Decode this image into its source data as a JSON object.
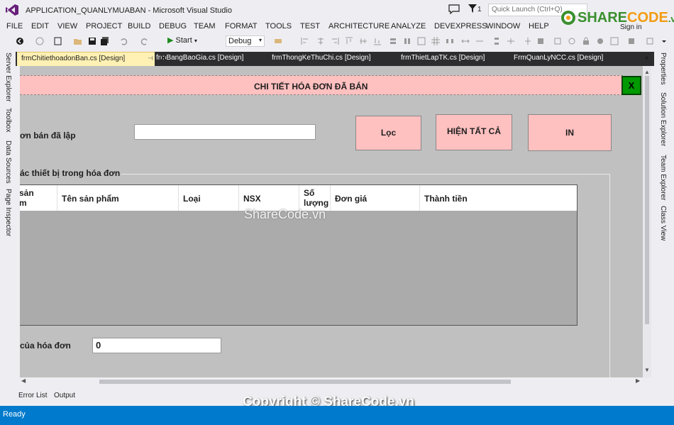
{
  "window": {
    "title": "APPLICATION_QUANLYMUABAN - Microsoft Visual Studio",
    "filter_count": "1",
    "quick_launch_placeholder": "Quick Launch (Ctrl+Q)",
    "sign_in": "Sign in"
  },
  "menu": [
    "FILE",
    "EDIT",
    "VIEW",
    "PROJECT",
    "BUILD",
    "DEBUG",
    "TEAM",
    "FORMAT",
    "TOOLS",
    "TEST",
    "ARCHITECTURE",
    "ANALYZE",
    "DEVEXPRESS",
    "WINDOW",
    "HELP"
  ],
  "toolbar": {
    "start_label": "Start",
    "config_value": "Debug"
  },
  "left_rail": [
    "Server Explorer",
    "Toolbox",
    "Data Sources",
    "Page Inspector"
  ],
  "right_rail": [
    "Properties",
    "Solution Explorer",
    "Team Explorer",
    "Class View"
  ],
  "doc_tabs": [
    {
      "label": "frmChitiethoadonBan.cs [Design]",
      "active": true
    },
    {
      "label": "frmBangBaoGia.cs [Design]",
      "active": false
    },
    {
      "label": "frmThongKeThuChi.cs [Design]",
      "active": false
    },
    {
      "label": "frmThietLapTK.cs [Design]",
      "active": false
    },
    {
      "label": "FrmQuanLyNCC.cs [Design]",
      "active": false
    }
  ],
  "form": {
    "title": "CHI TIẾT HÓA ĐƠN ĐÃ BÁN",
    "close_label": "X",
    "invoice_label": "ơn bán đã lập",
    "invoice_value": "",
    "filter_button": "Lọc",
    "show_all_button": "HIỆN TẤT CẢ",
    "print_button": "IN",
    "group_title": "ác thiết bị trong hóa đơn",
    "columns": [
      "sản\nm",
      "Tên sản phẩm",
      "Loại",
      "NSX",
      "Số\nlượng",
      "Đơn giá",
      "Thành tiền"
    ],
    "total_label": "của hóa đơn",
    "total_value": "0"
  },
  "bottom_tabs": [
    "Error List",
    "Output"
  ],
  "status": "Ready",
  "watermark": {
    "center": "ShareCode.vn",
    "bottom": "Copyright © ShareCode.vn",
    "logo": "SHARECODE.vn",
    "logo_sub": ".vn"
  },
  "colors": {
    "accent": "#007acc",
    "form_pink": "#ffc0c0",
    "close_green": "#009900"
  }
}
